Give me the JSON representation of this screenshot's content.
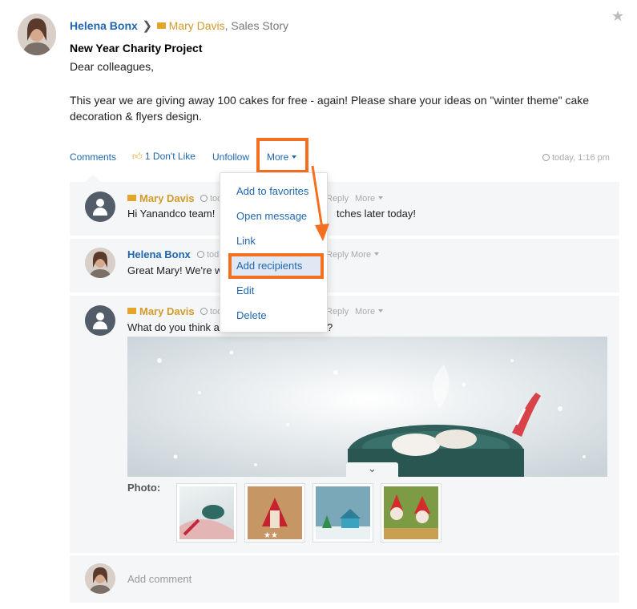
{
  "post": {
    "author": "Helena Bonx",
    "recipient": "Mary Davis",
    "recipient_group": ", Sales Story",
    "title": "New Year Charity Project",
    "greeting": "Dear colleagues,",
    "body": "This year we are giving away 100 cakes for free - again! Please share your ideas on \"winter theme\" cake decoration & flyers design.",
    "actions": {
      "comments": "Comments",
      "like_count": "1",
      "dont_like": "Don't Like",
      "unfollow": "Unfollow",
      "more": "More"
    },
    "timestamp": "today, 1:16 pm"
  },
  "menu": {
    "items": [
      "Add to favorites",
      "Open message",
      "Link",
      "Add recipients",
      "Edit",
      "Delete"
    ]
  },
  "comments": [
    {
      "author": "Mary Davis",
      "time": "tod",
      "reply": "Reply",
      "more": "More",
      "text_start": "Hi Yanandco team!",
      "text_end": "tches later today!"
    },
    {
      "author": "Helena Bonx",
      "time": "tod",
      "reply": "Reply",
      "more": "More",
      "text_start": "Great Mary! We're w",
      "text_end": ""
    },
    {
      "author": "Mary Davis",
      "time": "tod",
      "reply": "Reply",
      "more": "More",
      "text_start": "What do you think a",
      "text_end": "?"
    }
  ],
  "photo_label": "Photo:",
  "add_comment_placeholder": "Add comment",
  "icons": {
    "star": "star-icon",
    "arrow": "chevron-right-icon",
    "thumb": "thumbs-up-icon"
  },
  "colors": {
    "link": "#2067b0",
    "accent": "#d29b2a",
    "highlight": "#f37021"
  }
}
